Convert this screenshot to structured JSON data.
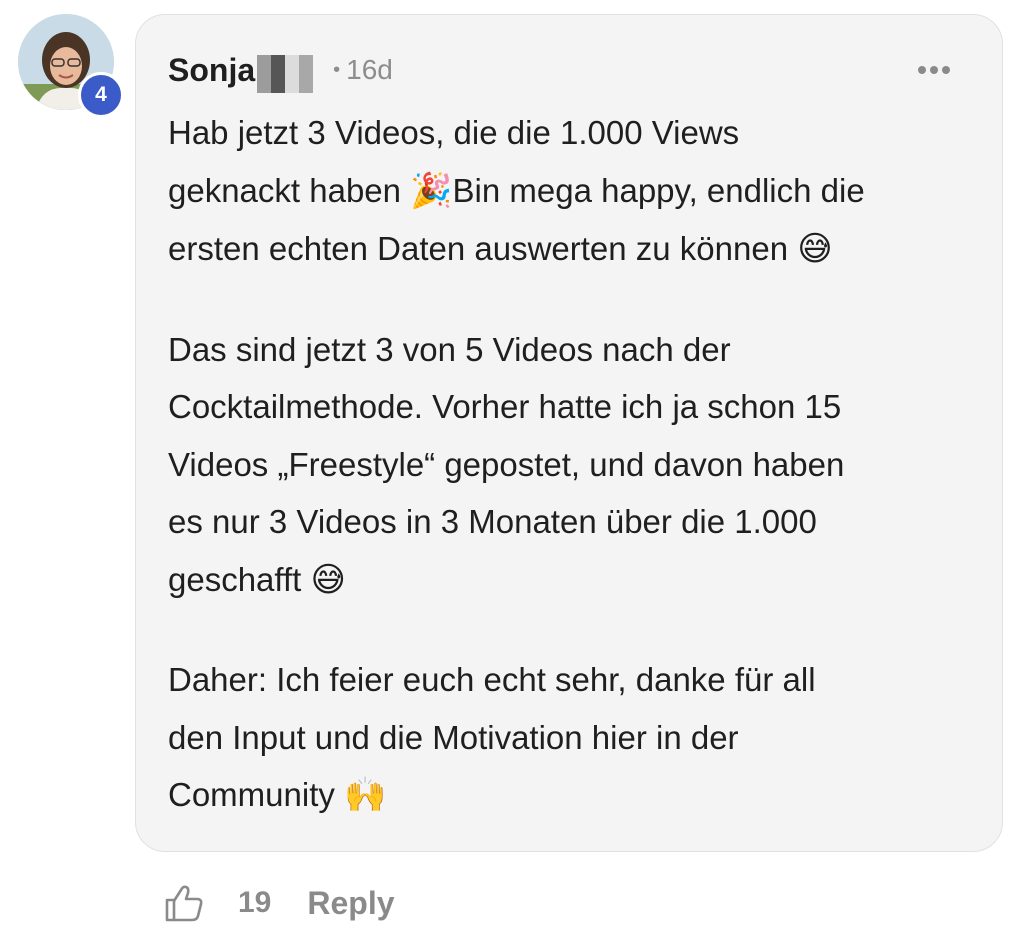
{
  "comment": {
    "author": "Sonja",
    "author_level": "4",
    "separator": "•",
    "timestamp": "16d",
    "paragraphs": [
      {
        "lines": [
          {
            "text": "Hab jetzt 3 Videos, die die 1.000 Views"
          },
          {
            "text": "geknackt haben ",
            "emoji": "🎉",
            "emoji_name": "party-popper-icon",
            "after": "Bin mega happy, endlich die"
          },
          {
            "text": "ersten echten Daten auswerten zu können ",
            "emoji": "😅",
            "emoji_name": "grinning-sweat-icon"
          }
        ]
      },
      {
        "lines": [
          {
            "text": "Das sind jetzt 3 von 5 Videos nach der"
          },
          {
            "text": "Cocktailmethode. Vorher hatte ich ja schon 15"
          },
          {
            "text": "Videos „Freestyle“ gepostet, und davon haben"
          },
          {
            "text": "es nur 3 Videos in 3 Monaten über die 1.000"
          },
          {
            "text": "geschafft ",
            "emoji": "😅",
            "emoji_name": "grinning-sweat-icon"
          }
        ]
      },
      {
        "lines": [
          {
            "text": "Daher: Ich feier euch echt sehr, danke für all"
          },
          {
            "text": "den Input und die Motivation hier in der"
          },
          {
            "text": "Community ",
            "emoji": "🙌",
            "emoji_name": "raising-hands-icon"
          }
        ]
      }
    ],
    "like_count": "19",
    "reply_label": "Reply"
  },
  "icons": {
    "more": "more-options-icon",
    "like": "thumbs-up-icon"
  },
  "colors": {
    "bubble_background": "#f5f4f4",
    "badge": "#3b5bc8",
    "muted_text": "#8a8a8a"
  }
}
